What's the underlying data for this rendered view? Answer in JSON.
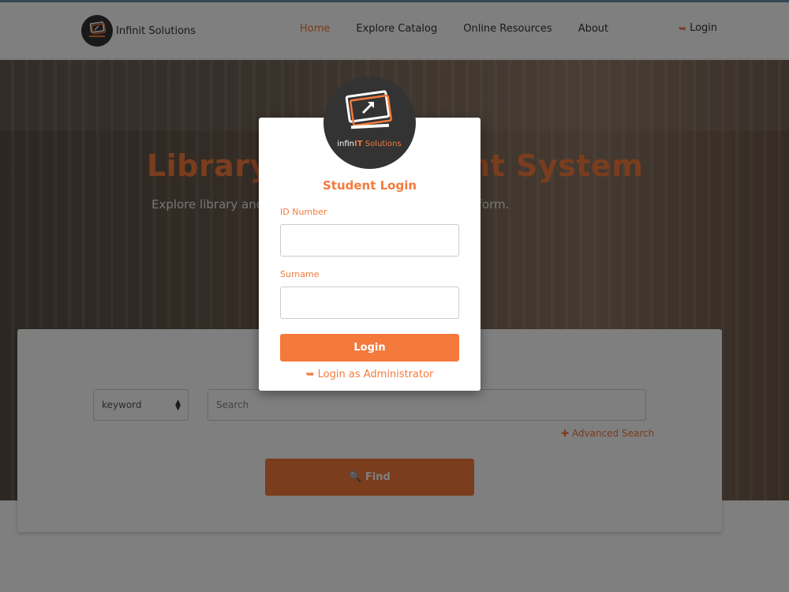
{
  "brand": {
    "name": "Infinit Solutions",
    "logo_icon": "monitor-cursor-logo"
  },
  "nav": {
    "items": [
      {
        "label": "Home",
        "active": true
      },
      {
        "label": "Explore Catalog",
        "active": false
      },
      {
        "label": "Online Resources",
        "active": false
      },
      {
        "label": "About",
        "active": false
      }
    ],
    "login": {
      "label": "Login",
      "icon": "sign-in-icon"
    }
  },
  "hero": {
    "title": "Library Management System",
    "subtitle": "Explore library and its resources through an online platform."
  },
  "search": {
    "type_select": {
      "value": "keyword"
    },
    "input_placeholder": "Search",
    "advanced_label": "Advanced Search",
    "find_label": "Find"
  },
  "modal": {
    "logo_text_prefix": "infin",
    "logo_text_bold": "IT",
    "logo_text_suffix": " Solutions",
    "title": "Student Login",
    "id_label": "ID Number",
    "surname_label": "Surname",
    "login_label": "Login",
    "admin_label": "Login as Administrator"
  },
  "colors": {
    "accent": "#f47a3c",
    "dark": "#333333"
  }
}
